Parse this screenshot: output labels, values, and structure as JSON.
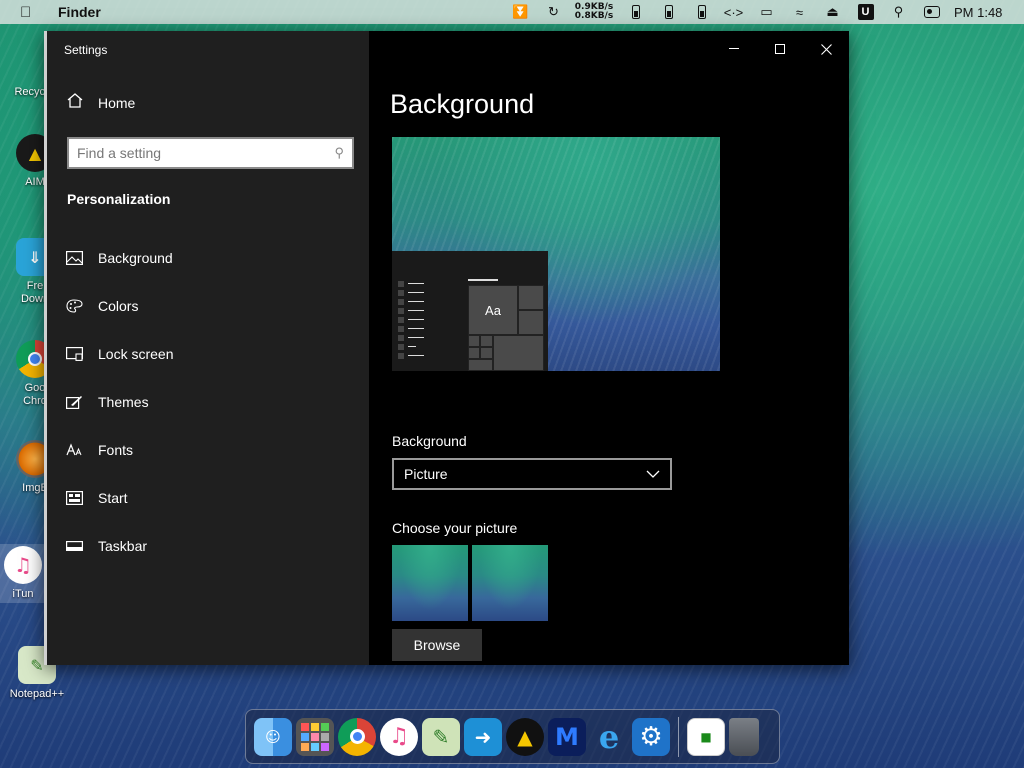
{
  "menubar": {
    "app_name": "Finder",
    "netspeed_up": "0.9KB/s",
    "netspeed_down": "0.8KB/s",
    "clock": "PM 1:48",
    "u_badge": "U"
  },
  "desktop": {
    "icons": [
      {
        "label": "Recycl",
        "icon": "recycle-bin-icon"
      },
      {
        "label": "AIM",
        "icon": "aimp-icon"
      },
      {
        "label": "Fre\nDown",
        "icon": "free-download-icon"
      },
      {
        "label": "Goo\nChro",
        "icon": "chrome-icon"
      },
      {
        "label": "ImgB",
        "icon": "imgburn-icon"
      },
      {
        "label": "iTun",
        "icon": "itunes-icon"
      },
      {
        "label": "Notepad++",
        "icon": "notepadpp-icon"
      }
    ]
  },
  "window": {
    "title": "Settings",
    "sidebar": {
      "home_label": "Home",
      "search_placeholder": "Find a setting",
      "section_title": "Personalization",
      "items": [
        {
          "label": "Background",
          "icon": "picture-icon"
        },
        {
          "label": "Colors",
          "icon": "palette-icon"
        },
        {
          "label": "Lock screen",
          "icon": "lock-screen-icon"
        },
        {
          "label": "Themes",
          "icon": "themes-icon"
        },
        {
          "label": "Fonts",
          "icon": "fonts-icon"
        },
        {
          "label": "Start",
          "icon": "start-icon"
        },
        {
          "label": "Taskbar",
          "icon": "taskbar-icon"
        }
      ]
    },
    "content": {
      "page_title": "Background",
      "preview_tile_text": "Aa",
      "background_label": "Background",
      "background_value": "Picture",
      "choose_label": "Choose your picture",
      "browse_label": "Browse"
    }
  },
  "colors": {
    "sidebar_bg": "#1f1f1f",
    "content_bg": "#000000",
    "button_bg": "#333333"
  }
}
